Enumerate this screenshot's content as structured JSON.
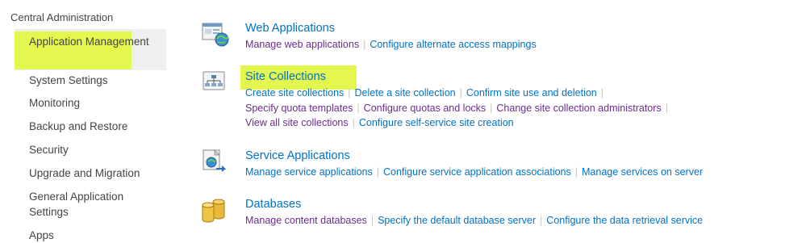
{
  "nav": {
    "root": "Central Administration",
    "items": [
      {
        "label": "Application Management"
      },
      {
        "label": "System Settings"
      },
      {
        "label": "Monitoring"
      },
      {
        "label": "Backup and Restore"
      },
      {
        "label": "Security"
      },
      {
        "label": "Upgrade and Migration"
      },
      {
        "label": "General Application Settings"
      },
      {
        "label": "Apps"
      }
    ]
  },
  "sections": {
    "web": {
      "title": "Web Applications",
      "icon": "web-applications-icon",
      "links": [
        "Manage web applications",
        "Configure alternate access mappings"
      ]
    },
    "site": {
      "title": "Site Collections",
      "icon": "site-collections-icon",
      "links": [
        "Create site collections",
        "Delete a site collection",
        "Confirm site use and deletion",
        "Specify quota templates",
        "Configure quotas and locks",
        "Change site collection administrators",
        "View all site collections",
        "Configure self-service site creation"
      ]
    },
    "service": {
      "title": "Service Applications",
      "icon": "service-applications-icon",
      "links": [
        "Manage service applications",
        "Configure service application associations",
        "Manage services on server"
      ]
    },
    "db": {
      "title": "Databases",
      "icon": "databases-icon",
      "links": [
        "Manage content databases",
        "Specify the default database server",
        "Configure the data retrieval service"
      ]
    }
  },
  "colors": {
    "highlight": "#e3f74e",
    "link_blue": "#0072c6",
    "link_visited": "#6a2d8f",
    "nav_text": "#444444",
    "separator": "#c6c6c6"
  }
}
